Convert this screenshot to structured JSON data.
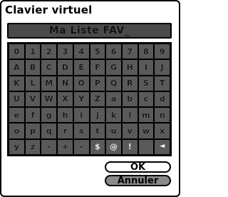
{
  "window": {
    "title": "Clavier virtuel"
  },
  "input": {
    "value": "Ma Liste FAV_"
  },
  "keyboard": {
    "rows": [
      [
        "0",
        "1",
        "2",
        "3",
        "4",
        "5",
        "6",
        "7",
        "8",
        "9"
      ],
      [
        "A",
        "B",
        "C",
        "D",
        "E",
        "F",
        "G",
        "H",
        "I",
        "J"
      ],
      [
        "K",
        "L",
        "M",
        "N",
        "O",
        "P",
        "Q",
        "R",
        "S",
        "T"
      ],
      [
        "U",
        "V",
        "W",
        "X",
        "Y",
        "Z",
        "a",
        "b",
        "c",
        "d"
      ],
      [
        "e",
        "f",
        "g",
        "h",
        "i",
        "j",
        "k",
        "l",
        "m",
        "n"
      ],
      [
        "o",
        "p",
        "q",
        "r",
        "s",
        "t",
        "u",
        "v",
        "w",
        "x"
      ],
      [
        "y",
        "z",
        "-",
        "+",
        "-",
        "$",
        "@",
        "!",
        "",
        "◄"
      ]
    ],
    "backspace_icon": "backspace-arrow-icon"
  },
  "buttons": {
    "ok_label": "OK",
    "cancel_label": "Annuler"
  },
  "colors": {
    "key_background": "#5b5b5b",
    "field_background": "#4a4a4a",
    "cancel_background": "#8a8a8a"
  }
}
